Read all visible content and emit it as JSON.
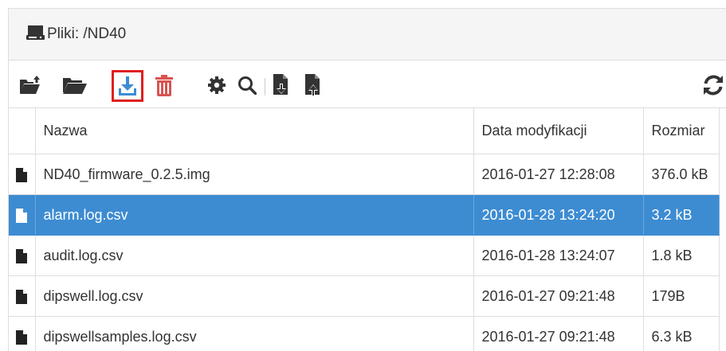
{
  "header": {
    "title": "Pliki: /ND40",
    "drive_icon": "hdd-icon"
  },
  "toolbar": {
    "buttons": [
      {
        "name": "upload-folder-icon",
        "color": "#333333"
      },
      {
        "name": "folder-open-icon",
        "color": "#333333"
      },
      {
        "name": "download-icon",
        "color": "#3d8cd2",
        "highlighted": true
      },
      {
        "name": "trash-icon",
        "color": "#d9534f"
      },
      {
        "name": "gear-icon",
        "color": "#333333"
      },
      {
        "name": "search-icon",
        "color": "#333333"
      },
      {
        "name": "file-download-icon",
        "color": "#333333"
      },
      {
        "name": "file-upload-icon",
        "color": "#333333"
      },
      {
        "name": "refresh-icon",
        "color": "#333333"
      }
    ],
    "highlight_color": "#e02020"
  },
  "table": {
    "columns": [
      "",
      "Nazwa",
      "Data modyfikacji",
      "Rozmiar"
    ],
    "rows": [
      {
        "name": "ND40_firmware_0.2.5.img",
        "modified": "2016-01-27 12:28:08",
        "size": "376.0 kB",
        "selected": false
      },
      {
        "name": "alarm.log.csv",
        "modified": "2016-01-28 13:24:20",
        "size": "3.2 kB",
        "selected": true
      },
      {
        "name": "audit.log.csv",
        "modified": "2016-01-28 13:24:07",
        "size": "1.8 kB",
        "selected": false
      },
      {
        "name": "dipswell.log.csv",
        "modified": "2016-01-27 09:21:48",
        "size": "179B",
        "selected": false
      },
      {
        "name": "dipswellsamples.log.csv",
        "modified": "2016-01-27 09:21:48",
        "size": "6.3 kB",
        "selected": false
      }
    ]
  },
  "colors": {
    "selection": "#3d8cd2",
    "header_bg": "#f5f5f5",
    "delete": "#d9534f",
    "accent": "#3d8cd2"
  }
}
